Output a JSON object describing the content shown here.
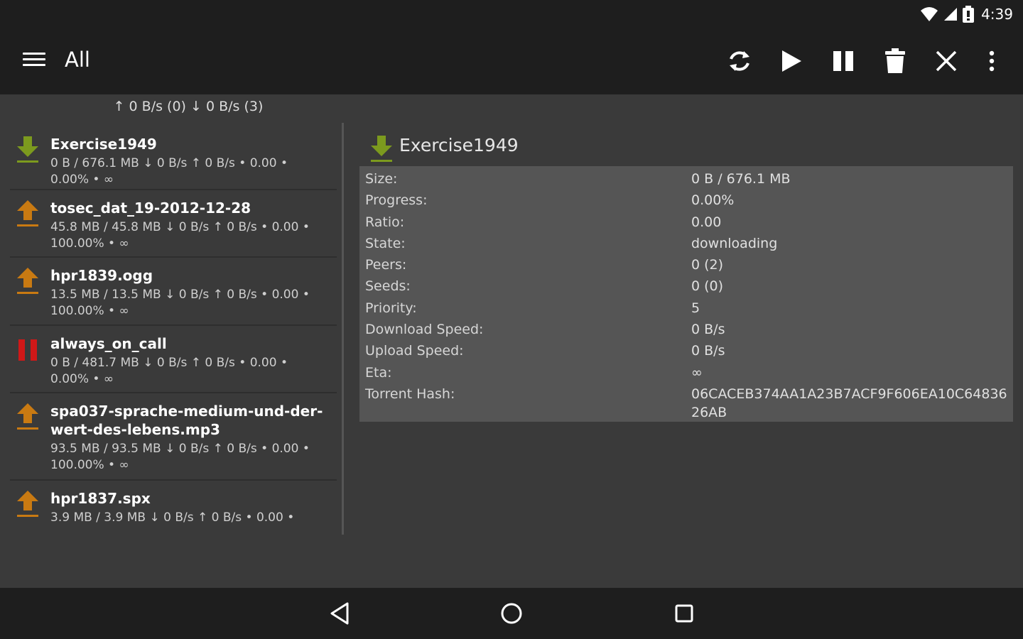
{
  "status": {
    "time": "4:39"
  },
  "toolbar": {
    "title": "All",
    "actions": [
      "refresh-icon",
      "play-icon",
      "pause-icon",
      "trash-icon",
      "close-icon",
      "overflow-icon"
    ]
  },
  "speed_summary": "↑ 0 B/s (0)  ↓ 0 B/s (3)",
  "torrents": [
    {
      "name": "Exercise1949",
      "info": "0 B / 676.1 MB ↓ 0 B/s ↑ 0 B/s • 0.00 • 0.00% • ∞",
      "state": "downloading"
    },
    {
      "name": "tosec_dat_19-2012-12-28",
      "info": "45.8 MB / 45.8 MB ↓ 0 B/s ↑ 0 B/s • 0.00 • 100.00% • ∞",
      "state": "seeding"
    },
    {
      "name": "hpr1839.ogg",
      "info": "13.5 MB / 13.5 MB ↓ 0 B/s ↑ 0 B/s • 0.00 • 100.00% • ∞",
      "state": "seeding"
    },
    {
      "name": "always_on_call",
      "info": "0 B / 481.7 MB ↓ 0 B/s ↑ 0 B/s • 0.00 • 0.00% • ∞",
      "state": "paused"
    },
    {
      "name": "spa037-sprache-medium-und-der-wert-des-lebens.mp3",
      "info": "93.5 MB / 93.5 MB ↓ 0 B/s ↑ 0 B/s • 0.00 • 100.00% • ∞",
      "state": "seeding"
    },
    {
      "name": "hpr1837.spx",
      "info": "3.9 MB / 3.9 MB ↓ 0 B/s ↑ 0 B/s • 0.00 •",
      "state": "seeding"
    }
  ],
  "detail": {
    "title": "Exercise1949",
    "rows": [
      {
        "label": "Size:",
        "value": "0 B / 676.1 MB"
      },
      {
        "label": "Progress:",
        "value": "0.00%"
      },
      {
        "label": "Ratio:",
        "value": "0.00"
      },
      {
        "label": "State:",
        "value": "downloading"
      },
      {
        "label": "Peers:",
        "value": "0 (2)"
      },
      {
        "label": "Seeds:",
        "value": "0 (0)"
      },
      {
        "label": "Priority:",
        "value": "5"
      },
      {
        "label": "Download Speed:",
        "value": "0 B/s"
      },
      {
        "label": "Upload Speed:",
        "value": "0 B/s"
      },
      {
        "label": "Eta:",
        "value": "∞"
      },
      {
        "label": "Torrent Hash:",
        "value": "06CACEB374AA1A23B7ACF9F606EA10C6483626AB"
      }
    ]
  },
  "colors": {
    "download": "#7c9a1e",
    "upload": "#c97a12",
    "paused": "#d01818"
  }
}
